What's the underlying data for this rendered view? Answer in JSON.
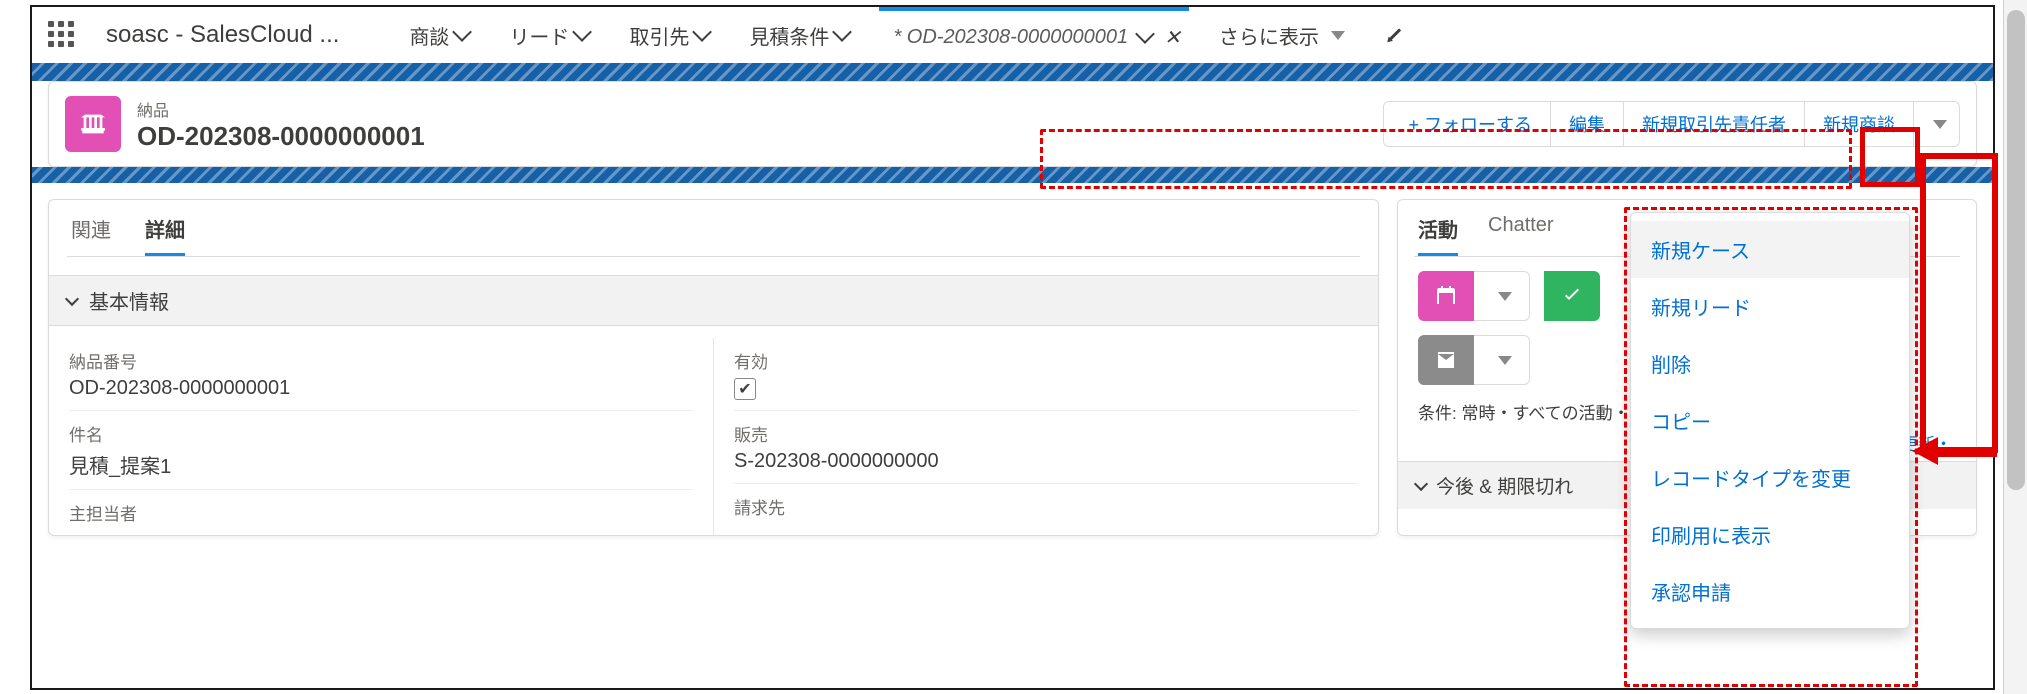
{
  "topnav": {
    "app_name": "soasc - SalesCloud ...",
    "items": [
      "商談",
      "リード",
      "取引先",
      "見積条件"
    ],
    "active_tab": "* OD-202308-0000000001",
    "more": "さらに表示"
  },
  "highlight": {
    "type": "納品",
    "name": "OD-202308-0000000001",
    "actions": {
      "follow": "+ フォローする",
      "edit": "編集",
      "new_contact": "新規取引先責任者",
      "new_opportunity": "新規商談"
    }
  },
  "left_panel": {
    "tabs": {
      "related": "関連",
      "details": "詳細"
    },
    "section_title": "基本情報",
    "fields": {
      "record_no_label": "納品番号",
      "record_no_value": "OD-202308-0000000001",
      "subject_label": "件名",
      "subject_value": "見積_提案1",
      "owner_label": "主担当者",
      "active_label": "有効",
      "active_checked": true,
      "sales_label": "販売",
      "sales_value": "S-202308-0000000000",
      "billto_label": "請求先"
    }
  },
  "right_panel": {
    "tabs": {
      "activity": "活動",
      "chatter": "Chatter"
    },
    "filter_text": "条件: 常時・すべての活動・すべての種別",
    "update_link": "更新・",
    "upcoming": "今後 & 期限切れ"
  },
  "dropdown": {
    "items": [
      "新規ケース",
      "新規リード",
      "削除",
      "コピー",
      "レコードタイプを変更",
      "印刷用に表示",
      "承認申請"
    ]
  }
}
